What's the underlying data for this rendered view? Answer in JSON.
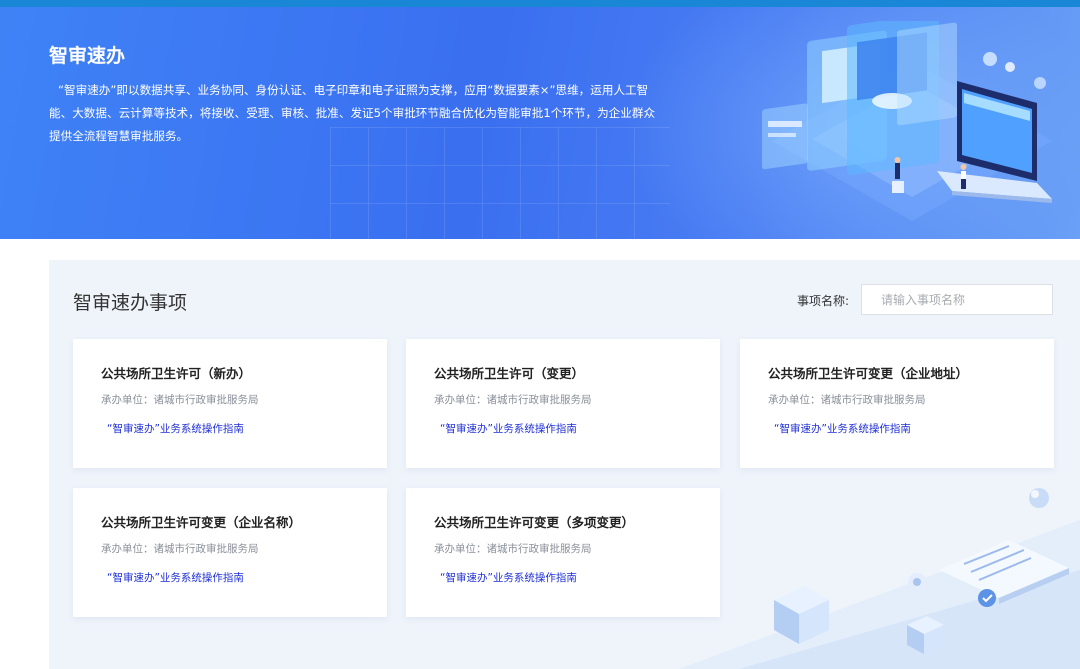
{
  "banner": {
    "title": "智审速办",
    "description": "“智审速办”即以数据共享、业务协同、身份认证、电子印章和电子证照为支撑，应用“数据要素×”思维，运用人工智能、大数据、云计算等技术，将接收、受理、审核、批准、发证5个审批环节融合优化为智能审批1个环节，为企业群众提供全流程智慧审批服务。"
  },
  "section": {
    "title": "智审速办事项",
    "search_label": "事项名称:",
    "search_placeholder": "请输入事项名称",
    "search_value": ""
  },
  "cards": [
    {
      "title": "公共场所卫生许可（新办）",
      "subtitle": "承办单位：诸城市行政审批服务局",
      "link": "“智审速办”业务系统操作指南"
    },
    {
      "title": "公共场所卫生许可（变更）",
      "subtitle": "承办单位：诸城市行政审批服务局",
      "link": "“智审速办”业务系统操作指南"
    },
    {
      "title": "公共场所卫生许可变更（企业地址）",
      "subtitle": "承办单位：诸城市行政审批服务局",
      "link": "“智审速办”业务系统操作指南"
    },
    {
      "title": "公共场所卫生许可变更（企业名称）",
      "subtitle": "承办单位：诸城市行政审批服务局",
      "link": "“智审速办”业务系统操作指南"
    },
    {
      "title": "公共场所卫生许可变更（多项变更）",
      "subtitle": "承办单位：诸城市行政审批服务局",
      "link": "“智审速办”业务系统操作指南"
    }
  ],
  "colors": {
    "banner_start": "#3f82f6",
    "top_bar": "#1a86d6",
    "panel_bg": "#eff4fb",
    "link": "#1f2fd6"
  }
}
